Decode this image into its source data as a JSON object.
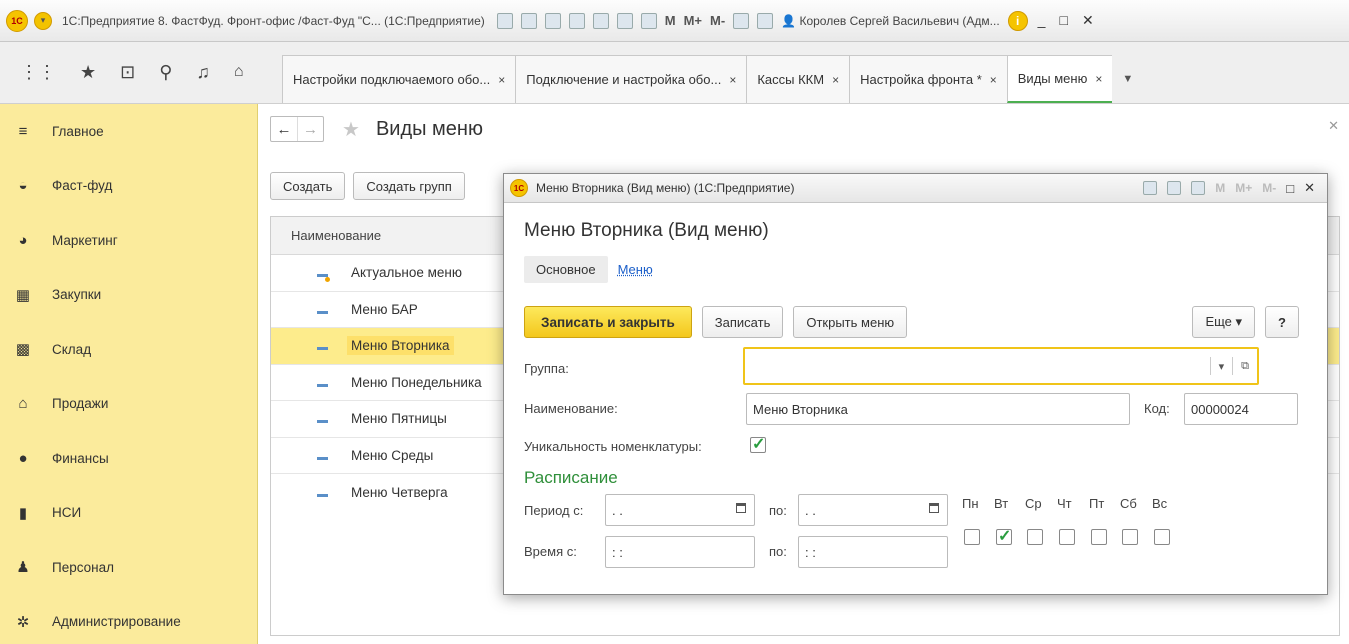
{
  "window": {
    "title": "1С:Предприятие 8. ФастФуд. Фронт-офис /Фаст-Фуд \"С... (1С:Предприятие)",
    "logo": "1С",
    "toolbar_m": [
      "M",
      "M+",
      "M-"
    ],
    "user": "Королев Сергей Васильевич (Адм...",
    "controls": [
      "_",
      "□",
      "✕"
    ]
  },
  "tabs": [
    {
      "label": "Настройки подключаемого обо...",
      "close": "×"
    },
    {
      "label": "Подключение и настройка обо...",
      "close": "×"
    },
    {
      "label": "Кассы ККМ",
      "close": "×"
    },
    {
      "label": "Настройка фронта *",
      "close": "×"
    },
    {
      "label": "Виды меню",
      "close": "×"
    }
  ],
  "sidebar": {
    "items": [
      {
        "label": "Главное",
        "icon": "menu-icon",
        "glyph": "≡"
      },
      {
        "label": "Фаст-фуд",
        "icon": "burger-icon",
        "glyph": "◒"
      },
      {
        "label": "Маркетинг",
        "icon": "pie-icon",
        "glyph": "◕"
      },
      {
        "label": "Закупки",
        "icon": "purchases-icon",
        "glyph": "▦"
      },
      {
        "label": "Склад",
        "icon": "warehouse-icon",
        "glyph": "▩"
      },
      {
        "label": "Продажи",
        "icon": "basket-icon",
        "glyph": "⌂"
      },
      {
        "label": "Финансы",
        "icon": "finance-icon",
        "glyph": "●"
      },
      {
        "label": "НСИ",
        "icon": "book-icon",
        "glyph": "▮"
      },
      {
        "label": "Персонал",
        "icon": "person-icon",
        "glyph": "♟"
      },
      {
        "label": "Администрирование",
        "icon": "gear-icon",
        "glyph": "✲"
      }
    ]
  },
  "list": {
    "title": "Виды меню",
    "buttons": {
      "create": "Создать",
      "create_group": "Создать групп"
    },
    "column": "Наименование",
    "rows": [
      {
        "label": "Актуальное меню"
      },
      {
        "label": "Меню БАР"
      },
      {
        "label": "Меню Вторника"
      },
      {
        "label": "Меню Понедельника"
      },
      {
        "label": "Меню Пятницы"
      },
      {
        "label": "Меню Среды"
      },
      {
        "label": "Меню Четверга"
      }
    ]
  },
  "modal": {
    "window_title": "Меню Вторника (Вид меню)  (1С:Предприятие)",
    "heading": "Меню Вторника (Вид меню)",
    "tab_main": "Основное",
    "tab_link": "Меню",
    "btn_save_close": "Записать и закрыть",
    "btn_save": "Записать",
    "btn_open_menu": "Открыть меню",
    "btn_more": "Еще ▾",
    "btn_help": "?",
    "label_group": "Группа:",
    "group_value": "",
    "label_name": "Наименование:",
    "name_value": "Меню Вторника",
    "label_code": "Код:",
    "code_value": "00000024",
    "label_unique": "Уникальность номенклатуры:",
    "unique_checked": true,
    "schedule_title": "Расписание",
    "label_period_from": "Период с:",
    "period_from_value": " .  .",
    "label_to": "по:",
    "period_to_value": " .  .",
    "label_time_from": "Время с:",
    "time_from_value": " :  :",
    "time_to_value": " :  :",
    "days": [
      {
        "label": "Пн",
        "checked": false
      },
      {
        "label": "Вт",
        "checked": true
      },
      {
        "label": "Ср",
        "checked": false
      },
      {
        "label": "Чт",
        "checked": false
      },
      {
        "label": "Пт",
        "checked": false
      },
      {
        "label": "Сб",
        "checked": false
      },
      {
        "label": "Вс",
        "checked": false
      }
    ]
  },
  "colors": {
    "sidebar_bg": "#fbeb9c",
    "accent_yellow": "#f3c71c",
    "selection": "#fdec8c",
    "link": "#1a5ec9",
    "schedule_green": "#2f8f3a"
  }
}
